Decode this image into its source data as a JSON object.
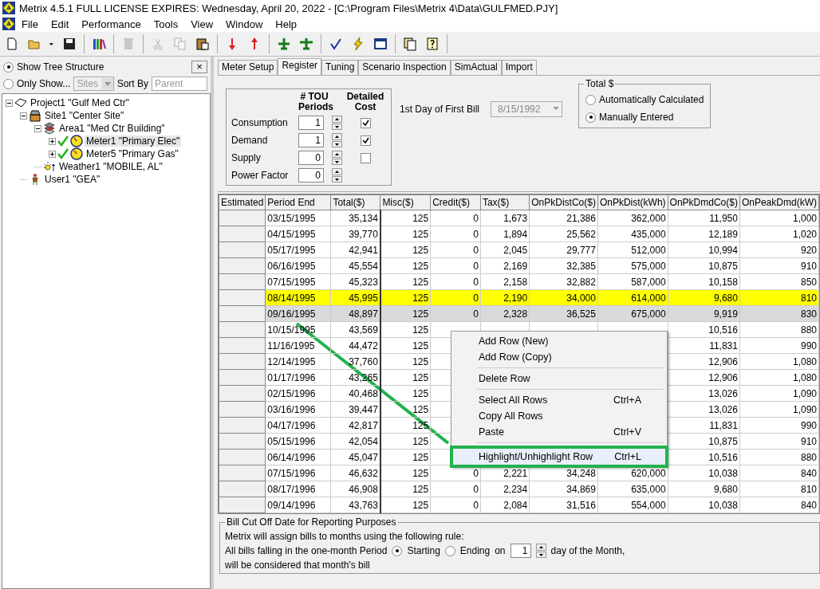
{
  "window": {
    "title": "Metrix 4.5.1 FULL LICENSE EXPIRES: Wednesday, April 20, 2022 - [C:\\Program Files\\Metrix 4\\Data\\GULFMED.PJY]"
  },
  "menu_bar": [
    "File",
    "Edit",
    "Performance",
    "Tools",
    "View",
    "Window",
    "Help"
  ],
  "toolbar": [
    {
      "kind": "new",
      "disabled": false
    },
    {
      "kind": "open",
      "disabled": false
    },
    {
      "kind": "caret",
      "disabled": false
    },
    {
      "kind": "save",
      "disabled": false
    },
    {
      "kind": "sep"
    },
    {
      "kind": "books",
      "disabled": false
    },
    {
      "kind": "sep"
    },
    {
      "kind": "trash",
      "disabled": true
    },
    {
      "kind": "sep"
    },
    {
      "kind": "cut",
      "disabled": true
    },
    {
      "kind": "copy",
      "disabled": true
    },
    {
      "kind": "paste",
      "disabled": false
    },
    {
      "kind": "sep"
    },
    {
      "kind": "down",
      "disabled": false
    },
    {
      "kind": "up",
      "disabled": false
    },
    {
      "kind": "sep"
    },
    {
      "kind": "plane",
      "disabled": false
    },
    {
      "kind": "plane2",
      "disabled": false
    },
    {
      "kind": "sep"
    },
    {
      "kind": "check",
      "disabled": false
    },
    {
      "kind": "bolt",
      "disabled": false
    },
    {
      "kind": "window",
      "disabled": false
    },
    {
      "kind": "sep"
    },
    {
      "kind": "doc",
      "disabled": false
    },
    {
      "kind": "help",
      "disabled": false
    },
    {
      "kind": "sep"
    }
  ],
  "tree_options": {
    "close": "×",
    "modes": [
      {
        "label": "Show Tree Structure",
        "selected": true
      },
      {
        "label": "Only Show...",
        "selected": false
      }
    ],
    "filter": {
      "value": "Sites",
      "disabled": true
    },
    "sort_by": {
      "label": "Sort By",
      "placeholder": "Parent"
    }
  },
  "tree": [
    {
      "kind": "project",
      "label": "Project1 \"Gulf Med Ctr\"",
      "expanded": true,
      "children": [
        {
          "kind": "site",
          "label": "Site1 \"Center Site\"",
          "expanded": true,
          "children": [
            {
              "kind": "area",
              "label": "Area1 \"Med Ctr Building\"",
              "expanded": true,
              "children": [
                {
                  "kind": "meter",
                  "label": "Meter1 \"Primary Elec\"",
                  "expanded": false,
                  "checked": true,
                  "selected": true
                },
                {
                  "kind": "meter",
                  "label": "Meter5 \"Primary Gas\"",
                  "expanded": false,
                  "checked": true,
                  "selected": false
                }
              ]
            },
            {
              "kind": "weather",
              "label": "Weather1 \"MOBILE, AL\""
            }
          ]
        },
        {
          "kind": "user",
          "label": "User1 \"GEA\""
        }
      ]
    }
  ],
  "tabs": [
    {
      "label": "Meter Setup",
      "selected": false
    },
    {
      "label": "Register",
      "selected": true
    },
    {
      "label": "Tuning",
      "selected": false
    },
    {
      "label": "Scenario Inspection",
      "selected": false
    },
    {
      "label": "SimActual",
      "selected": false
    },
    {
      "label": "Import",
      "selected": false
    }
  ],
  "register": {
    "headers": [
      "# TOU Periods",
      "Detailed Cost"
    ],
    "rows": [
      {
        "label": "Consumption",
        "periods": "1",
        "detailed_cost": true
      },
      {
        "label": "Demand",
        "periods": "1",
        "detailed_cost": true
      },
      {
        "label": "Supply",
        "periods": "0",
        "detailed_cost": false
      },
      {
        "label": "Power Factor",
        "periods": "0"
      }
    ],
    "first_bill": {
      "label": "1st Day of First Bill",
      "value": "8/15/1992",
      "disabled": true
    },
    "total": {
      "title": "Total $",
      "options": [
        {
          "label": "Automatically Calculated",
          "selected": false
        },
        {
          "label": "Manually Entered",
          "selected": true
        }
      ]
    }
  },
  "table": {
    "row_header": "Estimated",
    "columns": [
      "Period End",
      "Total($)",
      "Misc($)",
      "Credit($)",
      "Tax($)",
      "OnPkDistCo($)",
      "OnPkDist(kWh)",
      "OnPkDmdCo($)",
      "OnPeakDmd(kW)"
    ],
    "rows": [
      {
        "cells": [
          "03/15/1995",
          "35,134",
          "125",
          "0",
          "1,673",
          "21,386",
          "362,000",
          "11,950",
          "1,000"
        ],
        "highlighted": false,
        "selected": false
      },
      {
        "cells": [
          "04/15/1995",
          "39,770",
          "125",
          "0",
          "1,894",
          "25,562",
          "435,000",
          "12,189",
          "1,020"
        ],
        "highlighted": false,
        "selected": false
      },
      {
        "cells": [
          "05/17/1995",
          "42,941",
          "125",
          "0",
          "2,045",
          "29,777",
          "512,000",
          "10,994",
          "920"
        ],
        "highlighted": false,
        "selected": false
      },
      {
        "cells": [
          "06/16/1995",
          "45,554",
          "125",
          "0",
          "2,169",
          "32,385",
          "575,000",
          "10,875",
          "910"
        ],
        "highlighted": false,
        "selected": false
      },
      {
        "cells": [
          "07/15/1995",
          "45,323",
          "125",
          "0",
          "2,158",
          "32,882",
          "587,000",
          "10,158",
          "850"
        ],
        "highlighted": false,
        "selected": false
      },
      {
        "cells": [
          "08/14/1995",
          "45,995",
          "125",
          "0",
          "2,190",
          "34,000",
          "614,000",
          "9,680",
          "810"
        ],
        "highlighted": true,
        "selected": false
      },
      {
        "cells": [
          "09/16/1995",
          "48,897",
          "125",
          "0",
          "2,328",
          "36,525",
          "675,000",
          "9,919",
          "830"
        ],
        "highlighted": false,
        "selected": true
      },
      {
        "cells": [
          "10/15/1995",
          "43,569",
          "125",
          null,
          null,
          null,
          null,
          "10,516",
          "880"
        ],
        "highlighted": false,
        "selected": false
      },
      {
        "cells": [
          "11/16/1995",
          "44,472",
          "125",
          null,
          null,
          null,
          null,
          "11,831",
          "990"
        ],
        "highlighted": false,
        "selected": false
      },
      {
        "cells": [
          "12/14/1995",
          "37,760",
          "125",
          null,
          null,
          null,
          null,
          "12,906",
          "1,080"
        ],
        "highlighted": false,
        "selected": false
      },
      {
        "cells": [
          "01/17/1996",
          "43,265",
          "125",
          null,
          null,
          null,
          null,
          "12,906",
          "1,080"
        ],
        "highlighted": false,
        "selected": false
      },
      {
        "cells": [
          "02/15/1996",
          "40,468",
          "125",
          null,
          null,
          null,
          null,
          "13,026",
          "1,090"
        ],
        "highlighted": false,
        "selected": false
      },
      {
        "cells": [
          "03/16/1996",
          "39,447",
          "125",
          null,
          null,
          null,
          null,
          "13,026",
          "1,090"
        ],
        "highlighted": false,
        "selected": false
      },
      {
        "cells": [
          "04/17/1996",
          "42,817",
          "125",
          null,
          null,
          null,
          null,
          "11,831",
          "990"
        ],
        "highlighted": false,
        "selected": false
      },
      {
        "cells": [
          "05/15/1996",
          "42,054",
          "125",
          null,
          null,
          null,
          null,
          "10,875",
          "910"
        ],
        "highlighted": false,
        "selected": false
      },
      {
        "cells": [
          "06/14/1996",
          "45,047",
          "125",
          null,
          null,
          null,
          null,
          "10,516",
          "880"
        ],
        "highlighted": false,
        "selected": false
      },
      {
        "cells": [
          "07/15/1996",
          "46,632",
          "125",
          "0",
          "2,221",
          "34,248",
          "620,000",
          "10,038",
          "840"
        ],
        "highlighted": false,
        "selected": false
      },
      {
        "cells": [
          "08/17/1996",
          "46,908",
          "125",
          "0",
          "2,234",
          "34,869",
          "635,000",
          "9,680",
          "810"
        ],
        "highlighted": false,
        "selected": false
      },
      {
        "cells": [
          "09/14/1996",
          "43,763",
          "125",
          "0",
          "2,084",
          "31,516",
          "554,000",
          "10,038",
          "840"
        ],
        "highlighted": false,
        "selected": false
      }
    ]
  },
  "context_menu": [
    {
      "kind": "item",
      "label": "Add Row (New)"
    },
    {
      "kind": "item",
      "label": "Add Row (Copy)"
    },
    {
      "kind": "separator"
    },
    {
      "kind": "item",
      "label": "Delete Row"
    },
    {
      "kind": "separator"
    },
    {
      "kind": "item",
      "label": "Select All Rows",
      "shortcut": "Ctrl+A"
    },
    {
      "kind": "item",
      "label": "Copy All Rows"
    },
    {
      "kind": "item",
      "label": "Paste",
      "shortcut": "Ctrl+V"
    },
    {
      "kind": "separator"
    },
    {
      "kind": "item",
      "label": "Highlight/Unhighlight Row",
      "shortcut": "Ctrl+L",
      "outlined": true
    }
  ],
  "cutoff": {
    "title": "Bill Cut Off Date for Reporting Purposes",
    "intro": "Metrix will assign bills to months using the following rule:",
    "lead": "All bills falling in the one-month Period",
    "options": [
      {
        "label": "Starting",
        "selected": true
      },
      {
        "label": "Ending",
        "selected": false
      }
    ],
    "on": "on",
    "day": "1",
    "trail": "day of the Month,",
    "closing": "will be considered that month's bill"
  }
}
